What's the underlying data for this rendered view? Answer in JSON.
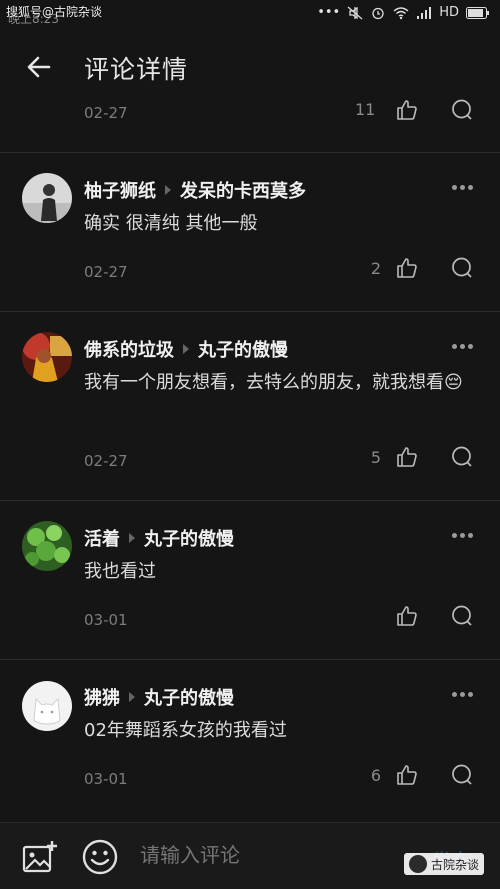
{
  "status_bar": {
    "watermark": "搜狐号@古院杂谈",
    "time": "晚上8:23",
    "network": "HD"
  },
  "header": {
    "title": "评论详情"
  },
  "partial_comment": {
    "date": "02-27",
    "likes": "11"
  },
  "comments": [
    {
      "author": "柚子狮纸",
      "reply_to": "发呆的卡西莫多",
      "text": "确实 很清纯 其他一般",
      "date": "02-27",
      "likes": "2",
      "avatar": "avatar-person-bw"
    },
    {
      "author": "佛系的垃圾",
      "reply_to": "丸子的傲慢",
      "text": "我有一个朋友想看，去特么的朋友，就我想看😔",
      "date": "02-27",
      "likes": "5",
      "avatar": "avatar-red-figure"
    },
    {
      "author": "活着",
      "reply_to": "丸子的傲慢",
      "text": "我也看过",
      "date": "03-01",
      "likes": "",
      "avatar": "avatar-green-leaves"
    },
    {
      "author": "狒狒",
      "reply_to": "丸子的傲慢",
      "text": "02年舞蹈系女孩的我看过",
      "date": "03-01",
      "likes": "6",
      "avatar": "avatar-white-cat"
    }
  ],
  "bottom_bar": {
    "input_placeholder": "请输入评论",
    "send_label": "发布",
    "watermark": "古院杂谈"
  },
  "colors": {
    "background": "#151515",
    "divider": "#2c2c2c",
    "muted_text": "#7d7d7d",
    "send_disabled": "#2a4f7a"
  }
}
